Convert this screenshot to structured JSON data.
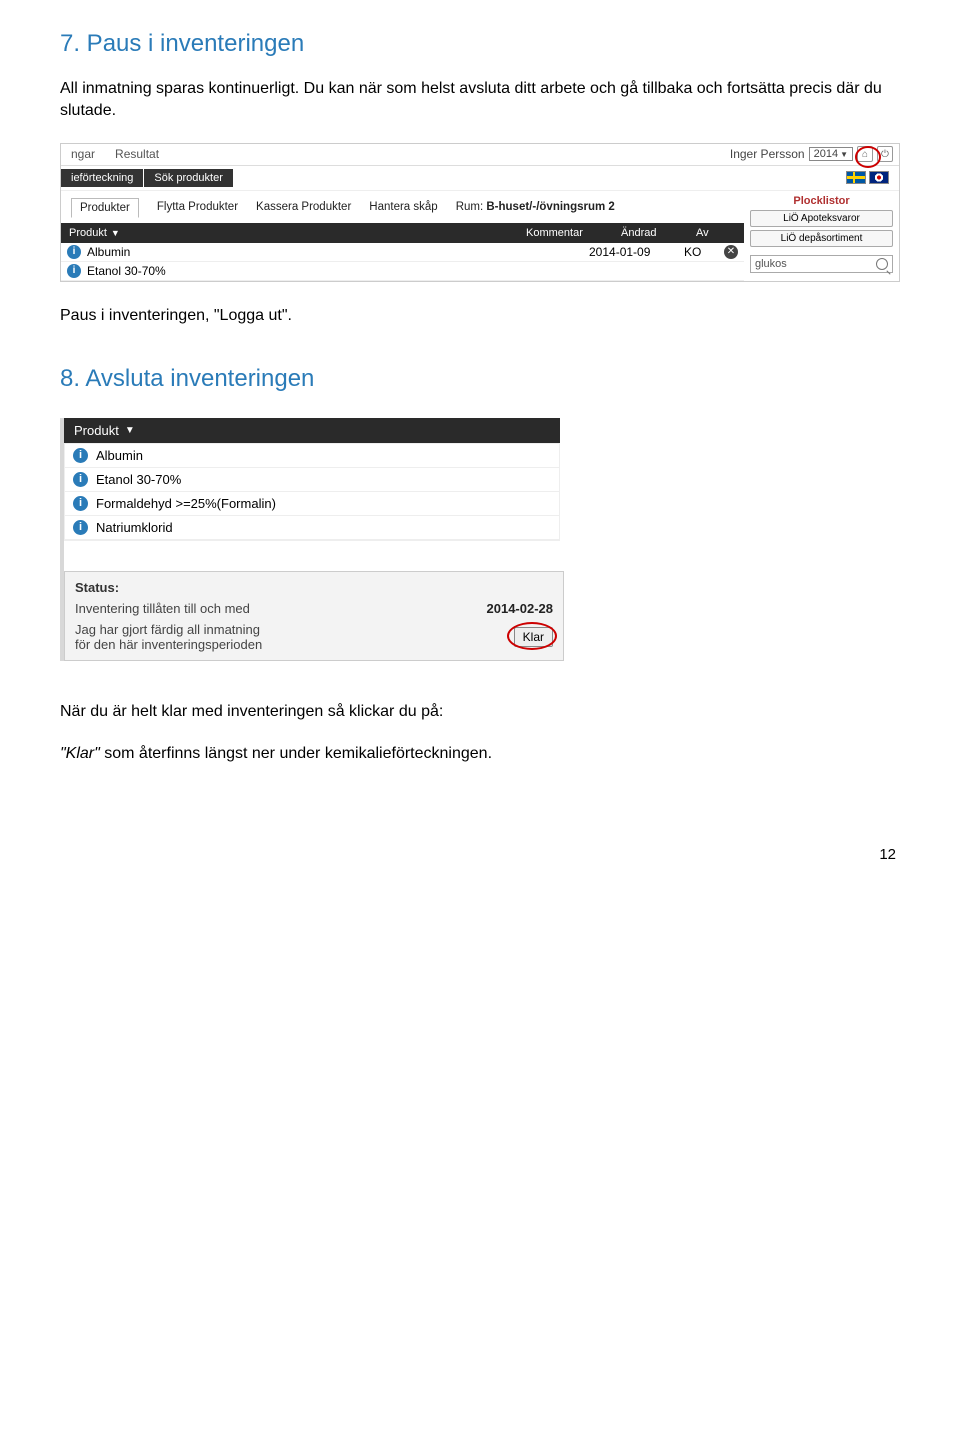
{
  "heading7": "7. Paus i inventeringen",
  "para1": "All inmatning sparas kontinuerligt. Du kan när som helst avsluta ditt arbete och gå tillbaka och fortsätta precis där du slutade.",
  "shot1": {
    "topTabs": [
      "ngar",
      "Resultat"
    ],
    "user": "Inger Persson",
    "year": "2014",
    "greyTabs": [
      "ieförteckning",
      "Sök produkter"
    ],
    "subTabs": {
      "selected": "Produkter",
      "others": [
        "Flytta Produkter",
        "Kassera Produkter",
        "Hantera skåp"
      ],
      "rumLabel": "Rum:",
      "rumValue": "B-huset/-/övningsrum 2"
    },
    "headers": {
      "produkt": "Produkt",
      "kommentar": "Kommentar",
      "andrad": "Ändrad",
      "av": "Av"
    },
    "rows": [
      {
        "name": "Albumin",
        "date": "2014-01-09",
        "av": "KO",
        "close": true
      },
      {
        "name": "Etanol 30-70%",
        "date": "",
        "av": "",
        "close": false
      }
    ],
    "right": {
      "title": "Plocklistor",
      "pills": [
        "LiÖ Apoteksvaror",
        "LiÖ depåsortiment"
      ],
      "search": "glukos"
    }
  },
  "caption1": "Paus i inventeringen, \"Logga ut\".",
  "heading8": "8. Avsluta inventeringen",
  "shot2": {
    "header": "Produkt",
    "items": [
      "Albumin",
      "Etanol 30-70%",
      "Formaldehyd >=25%(Formalin)",
      "Natriumklorid"
    ],
    "status": {
      "label": "Status:",
      "tillLabel": "Inventering tillåten till och med",
      "tillDate": "2014-02-28",
      "doneLine1": "Jag har gjort färdig all inmatning",
      "doneLine2": "för den här inventeringsperioden",
      "klar": "Klar"
    }
  },
  "para2a": "När du är helt klar med inventeringen så klickar du på:",
  "para2b_italic": "\"Klar\"",
  "para2b_rest": " som återfinns längst ner under kemikalieförteckningen.",
  "pageNum": "12"
}
